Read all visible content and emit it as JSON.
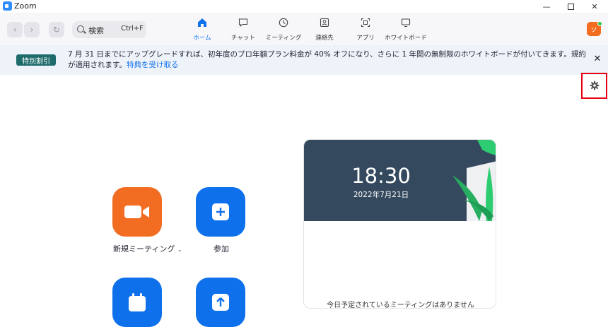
{
  "window": {
    "title": "Zoom"
  },
  "toolbar": {
    "search_label": "検索",
    "search_shortcut": "Ctrl+F",
    "tabs": [
      {
        "label": "ホーム",
        "icon": "home-icon",
        "active": true
      },
      {
        "label": "チャット",
        "icon": "chat-icon",
        "active": false
      },
      {
        "label": "ミーティング",
        "icon": "clock-icon",
        "active": false
      },
      {
        "label": "連絡先",
        "icon": "contacts-icon",
        "active": false
      },
      {
        "label": "アプリ",
        "icon": "apps-icon",
        "active": false
      },
      {
        "label": "ホワイトボード",
        "icon": "whiteboard-icon",
        "active": false
      }
    ],
    "avatar_initial": "ソ"
  },
  "banner": {
    "badge": "特別割引",
    "text": "7 月 31 日までにアップグレードすれば、初年度のプロ年額プラン料金が 40% オフになり、さらに 1 年間の無制限のホワイトボードが付いてきます。規約が適用されます。",
    "link": "特典を受け取る"
  },
  "actions": {
    "new_meeting": "新規ミーティング",
    "join": "参加"
  },
  "card": {
    "time": "18:30",
    "date": "2022年7月21日",
    "empty_message": "今日予定されているミーティングはありません"
  },
  "colors": {
    "accent": "#0e71eb",
    "orange": "#f26d21",
    "blue": "#0e71eb",
    "badge": "#1e6b6b",
    "highlight": "#e60012"
  }
}
